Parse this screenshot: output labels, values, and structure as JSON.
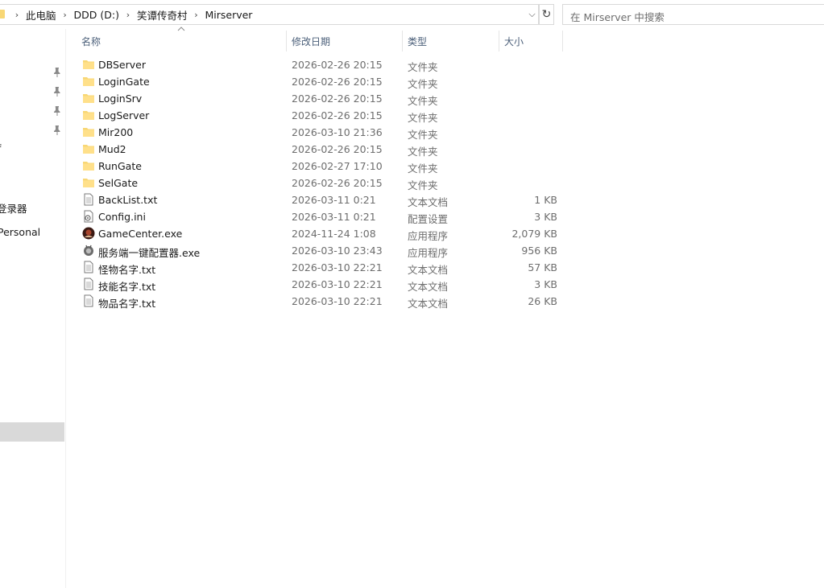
{
  "address_bar": {
    "breadcrumbs": [
      "此电脑",
      "DDD (D:)",
      "笑谭传奇村",
      "Mirserver"
    ]
  },
  "search": {
    "placeholder": "在 Mirserver 中搜索"
  },
  "nav_pane": {
    "partial_items": [
      "f",
      "登录器",
      "Personal"
    ]
  },
  "columns": {
    "name": "名称",
    "date": "修改日期",
    "type": "类型",
    "size": "大小"
  },
  "files": [
    {
      "name": "DBServer",
      "date": "2026-02-26 20:15",
      "type": "文件夹",
      "size": "",
      "icon": "folder-icon"
    },
    {
      "name": "LoginGate",
      "date": "2026-02-26 20:15",
      "type": "文件夹",
      "size": "",
      "icon": "folder-icon"
    },
    {
      "name": "LoginSrv",
      "date": "2026-02-26 20:15",
      "type": "文件夹",
      "size": "",
      "icon": "folder-icon"
    },
    {
      "name": "LogServer",
      "date": "2026-02-26 20:15",
      "type": "文件夹",
      "size": "",
      "icon": "folder-icon"
    },
    {
      "name": "Mir200",
      "date": "2026-03-10 21:36",
      "type": "文件夹",
      "size": "",
      "icon": "folder-icon"
    },
    {
      "name": "Mud2",
      "date": "2026-02-26 20:15",
      "type": "文件夹",
      "size": "",
      "icon": "folder-icon"
    },
    {
      "name": "RunGate",
      "date": "2026-02-27 17:10",
      "type": "文件夹",
      "size": "",
      "icon": "folder-icon"
    },
    {
      "name": "SelGate",
      "date": "2026-02-26 20:15",
      "type": "文件夹",
      "size": "",
      "icon": "folder-icon"
    },
    {
      "name": "BackList.txt",
      "date": "2026-03-11 0:21",
      "type": "文本文档",
      "size": "1 KB",
      "icon": "text-file-icon"
    },
    {
      "name": "Config.ini",
      "date": "2026-03-11 0:21",
      "type": "配置设置",
      "size": "3 KB",
      "icon": "settings-file-icon"
    },
    {
      "name": "GameCenter.exe",
      "date": "2024-11-24 1:08",
      "type": "应用程序",
      "size": "2,079 KB",
      "icon": "game-app-icon"
    },
    {
      "name": "服务端一键配置器.exe",
      "date": "2026-03-10 23:43",
      "type": "应用程序",
      "size": "956 KB",
      "icon": "config-app-icon"
    },
    {
      "name": "怪物名字.txt",
      "date": "2026-03-10 22:21",
      "type": "文本文档",
      "size": "57 KB",
      "icon": "text-file-icon"
    },
    {
      "name": "技能名字.txt",
      "date": "2026-03-10 22:21",
      "type": "文本文档",
      "size": "3 KB",
      "icon": "text-file-icon"
    },
    {
      "name": "物品名字.txt",
      "date": "2026-03-10 22:21",
      "type": "文本文档",
      "size": "26 KB",
      "icon": "text-file-icon"
    }
  ],
  "colors": {
    "folder": "#f8d775",
    "header_text": "#4c607a",
    "selected_nav": "#d9d9d9"
  }
}
